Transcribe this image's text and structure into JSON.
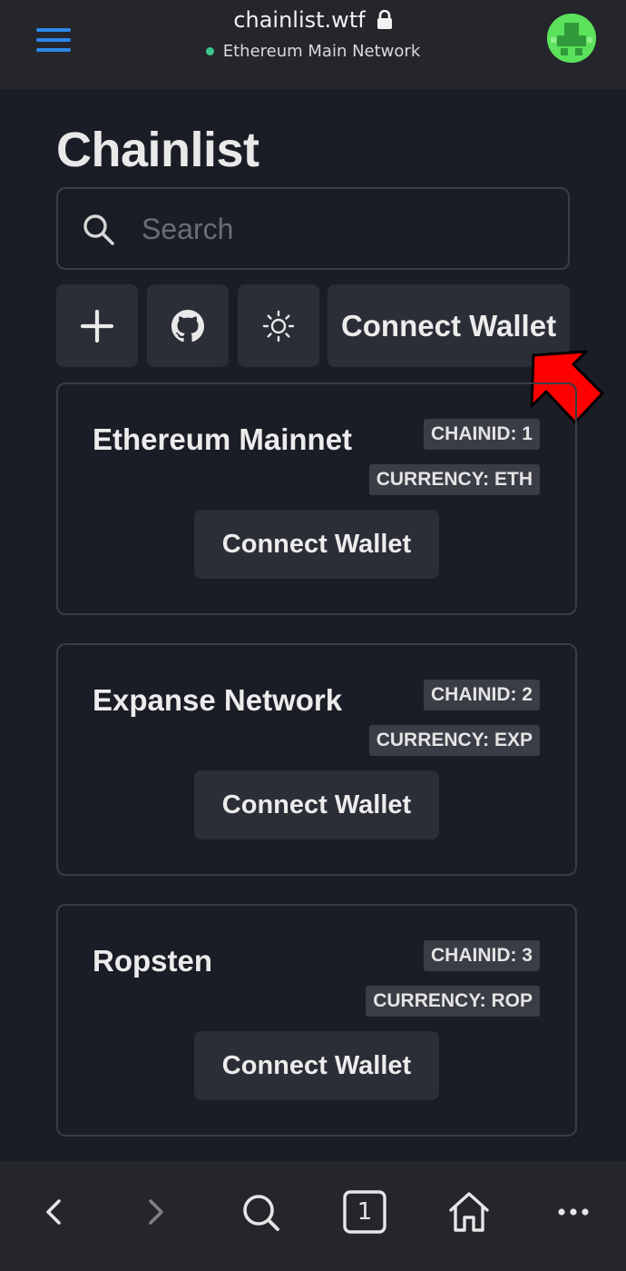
{
  "browser": {
    "url": "chainlist.wtf",
    "network": "Ethereum Main Network",
    "tab_count": "1"
  },
  "page": {
    "title": "Chainlist",
    "search_placeholder": "Search",
    "connect_wallet_label": "Connect Wallet"
  },
  "toolbar_icons": [
    "plus-icon",
    "github-icon",
    "sun-icon"
  ],
  "chains": [
    {
      "name": "Ethereum Mainnet",
      "chain_id": "CHAINID: 1",
      "currency": "CURRENCY: ETH",
      "button": "Connect Wallet"
    },
    {
      "name": "Expanse Network",
      "chain_id": "CHAINID: 2",
      "currency": "CURRENCY: EXP",
      "button": "Connect Wallet"
    },
    {
      "name": "Ropsten",
      "chain_id": "CHAINID: 3",
      "currency": "CURRENCY: ROP",
      "button": "Connect Wallet"
    }
  ],
  "bottom_nav_icons": [
    "back-icon",
    "forward-icon",
    "search-icon",
    "tabs-icon",
    "home-icon",
    "more-icon"
  ],
  "colors": {
    "background": "#1a1d25",
    "bar": "#24262c",
    "button": "#2b2e36",
    "badge": "#3a3d46",
    "accent_menu": "#2b88e8",
    "network_dot": "#3ac98b",
    "arrow": "#ff0000"
  }
}
